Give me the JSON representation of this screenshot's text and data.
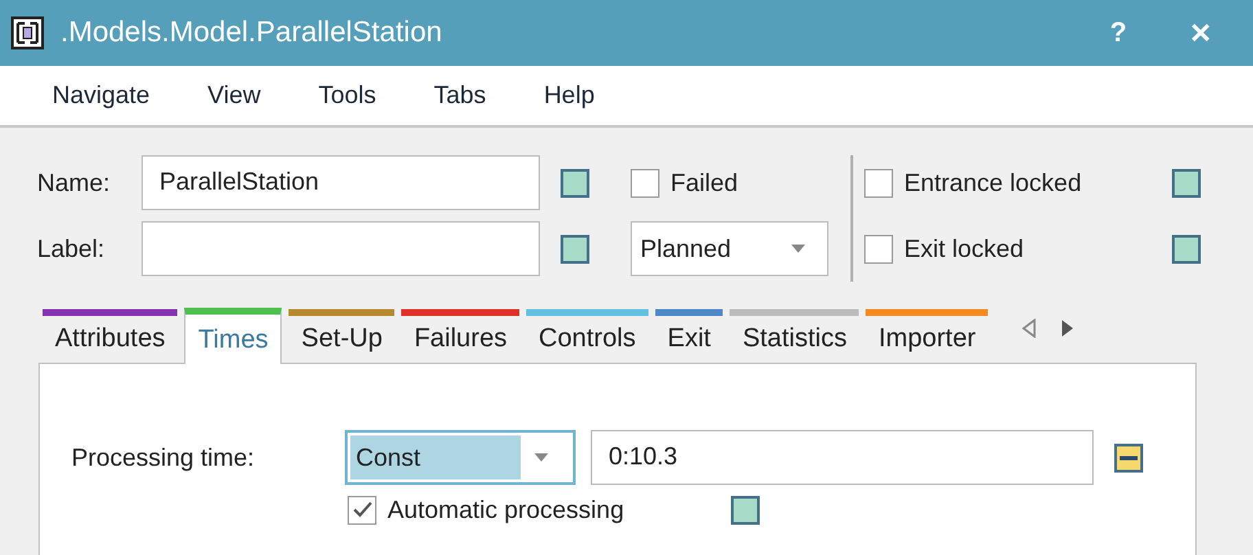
{
  "window": {
    "title": ".Models.Model.ParallelStation",
    "help": "?",
    "close": "✕"
  },
  "menu": [
    "Navigate",
    "View",
    "Tools",
    "Tabs",
    "Help"
  ],
  "header": {
    "name": {
      "label": "Name:",
      "value": "ParallelStation",
      "inherited": true
    },
    "label_field": {
      "label": "Label:",
      "inherited": true
    },
    "failed": {
      "label": "Failed",
      "checked": false
    },
    "availability": {
      "value": "Planned"
    },
    "entrance_locked": {
      "label": "Entrance locked",
      "checked": false,
      "inherited": true
    },
    "exit_locked": {
      "label": "Exit locked",
      "checked": false,
      "inherited": true
    }
  },
  "tabs": [
    {
      "label": "Attributes",
      "color": "#8434b0",
      "selected": false
    },
    {
      "label": "Times",
      "color": "#4cbf4c",
      "selected": true
    },
    {
      "label": "Set-Up",
      "color": "#b88a30",
      "selected": false
    },
    {
      "label": "Failures",
      "color": "#e0302a",
      "selected": false
    },
    {
      "label": "Controls",
      "color": "#64c0e0",
      "selected": false
    },
    {
      "label": "Exit",
      "color": "#4f88c6",
      "selected": false
    },
    {
      "label": "Statistics",
      "color": "#bcbcbc",
      "selected": false
    },
    {
      "label": "Importer",
      "color": "#f58a20",
      "selected": false
    }
  ],
  "times": {
    "processing_time": {
      "label": "Processing time:",
      "distribution": "Const",
      "value": "0:10.3",
      "inherited": false
    },
    "automatic_processing": {
      "label": "Automatic processing",
      "checked": true,
      "inherited": true
    }
  }
}
